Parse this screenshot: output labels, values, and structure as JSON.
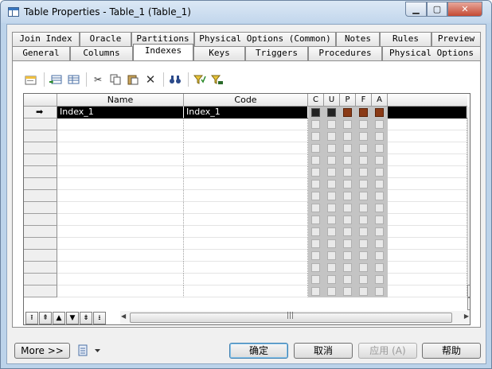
{
  "window": {
    "title": "Table Properties - Table_1 (Table_1)"
  },
  "tabs_row1": [
    "Join Index",
    "Oracle",
    "Partitions",
    "Physical Options (Common)",
    "Notes",
    "Rules",
    "Preview"
  ],
  "tabs_row2": [
    "General",
    "Columns",
    "Indexes",
    "Keys",
    "Triggers",
    "Procedures",
    "Physical Options"
  ],
  "selected_tab": "Indexes",
  "toolbar": {
    "properties": "properties-icon",
    "add_row": "add-row-icon",
    "insert_row": "insert-row-icon",
    "cut": "cut-icon",
    "copy": "copy-icon",
    "paste": "paste-icon",
    "delete": "delete-icon",
    "find": "find-icon",
    "filter": "filter-icon",
    "clear_filter": "clear-filter-icon"
  },
  "grid": {
    "columns": [
      "Name",
      "Code",
      "C",
      "U",
      "P",
      "F",
      "A"
    ],
    "rows": [
      {
        "name": "Index_1",
        "code": "Index_1",
        "c": "on",
        "u": "on",
        "p": "brown",
        "f": "brown",
        "a": "brown"
      }
    ],
    "current_row_marker": "➡"
  },
  "nav_buttons": [
    "⭱",
    "⇞",
    "▲",
    "▼",
    "⇟",
    "⭳"
  ],
  "buttons": {
    "more": "More >>",
    "ok": "确定",
    "cancel": "取消",
    "apply": "应用 (A)",
    "help": "帮助"
  },
  "colors": {
    "selection": "#000000",
    "title_gradient": "#c2d6ec",
    "check_brown": "#8a3a16"
  }
}
